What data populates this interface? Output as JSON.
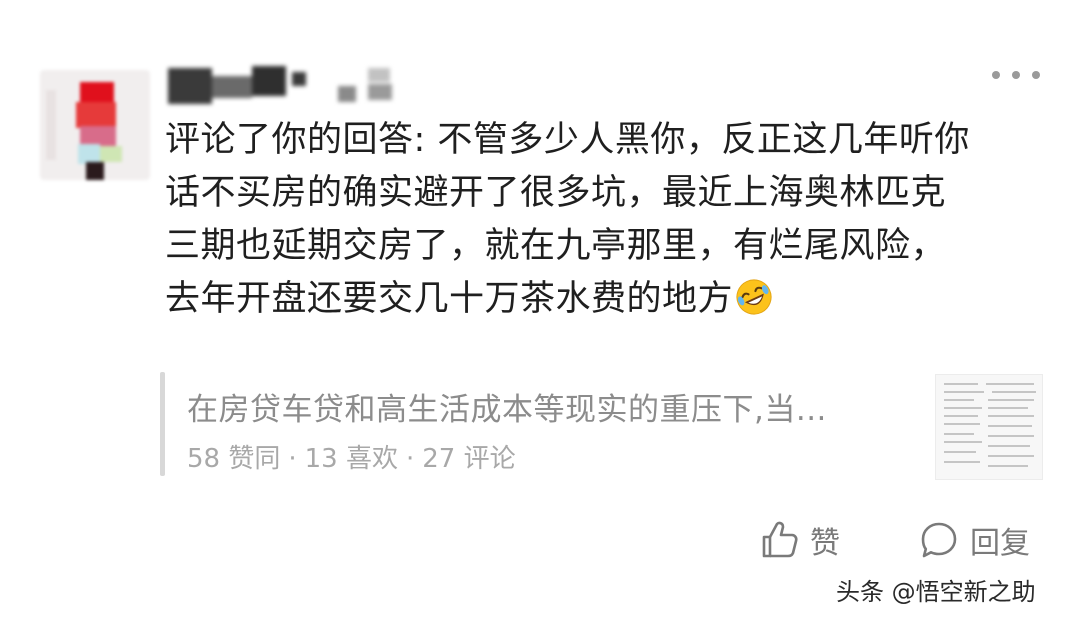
{
  "user": {
    "avatar_name": "avatar",
    "username": ""
  },
  "comment": {
    "lines": [
      "评论了你的回答: 不管多少人黑你，反正这几年听你",
      "话不买房的确实避开了很多坑，最近上海奥林匹克",
      "三期也延期交房了，就在九亭那里，有烂尾风险，",
      "去年开盘还要交几十万茶水费的地方"
    ],
    "emoji": "rolling-on-floor-laughing-emoji"
  },
  "quote": {
    "title": "在房贷车贷和高生活成本等现实的重压下,当...",
    "stats": {
      "agree": "58 赞同",
      "likes": "13 喜欢",
      "comments": "27 评论",
      "separator": "·"
    }
  },
  "actions": {
    "like_label": "赞",
    "reply_label": "回复"
  },
  "watermark": "头条 @悟空新之助",
  "colors": {
    "text": "#1f1f1f",
    "muted": "#8c8c8c",
    "stats": "#a8a8a8",
    "quote_bar": "#d8d8d8",
    "icon": "#7a7a7a"
  }
}
